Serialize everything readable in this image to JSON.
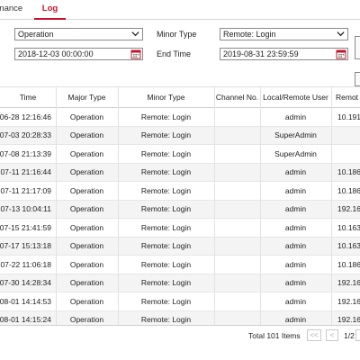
{
  "tabs": {
    "maintenance_partial": "enance",
    "log": "Log"
  },
  "filters": {
    "major_type": "Operation",
    "minor_type_label": "Minor Type",
    "minor_type": "Remote: Login",
    "start_time": "2018-12-03 00:00:00",
    "end_time_label": "End Time",
    "end_time": "2019-08-31 23:59:59"
  },
  "table": {
    "headers": [
      "Time",
      "Major Type",
      "Minor Type",
      "Channel No.",
      "Local/Remote User",
      "Remot"
    ],
    "rows": [
      [
        "06-28 12:16:46",
        "Operation",
        "Remote: Login",
        "",
        "admin",
        "10.191"
      ],
      [
        "07-03 20:28:33",
        "Operation",
        "Remote: Login",
        "",
        "SuperAdmin",
        ""
      ],
      [
        "07-08 21:13:39",
        "Operation",
        "Remote: Login",
        "",
        "SuperAdmin",
        ""
      ],
      [
        "07-11 21:16:44",
        "Operation",
        "Remote: Login",
        "",
        "admin",
        "10.186"
      ],
      [
        "07-11 21:17:09",
        "Operation",
        "Remote: Login",
        "",
        "admin",
        "10.186"
      ],
      [
        "07-13 10:04:11",
        "Operation",
        "Remote: Login",
        "",
        "admin",
        "192.16"
      ],
      [
        "07-15 21:41:59",
        "Operation",
        "Remote: Login",
        "",
        "admin",
        "10.163"
      ],
      [
        "07-17 15:13:18",
        "Operation",
        "Remote: Login",
        "",
        "admin",
        "10.163"
      ],
      [
        "07-22 11:06:18",
        "Operation",
        "Remote: Login",
        "",
        "admin",
        "10.186"
      ],
      [
        "07-30 14:28:34",
        "Operation",
        "Remote: Login",
        "",
        "admin",
        "192.16"
      ],
      [
        "08-01 14:14:53",
        "Operation",
        "Remote: Login",
        "",
        "admin",
        "192.16"
      ],
      [
        "08-01 14:15:24",
        "Operation",
        "Remote: Login",
        "",
        "admin",
        "192.16"
      ]
    ]
  },
  "pagination": {
    "total": "Total 101 Items",
    "first": "<<",
    "prev": "<",
    "page": "1/2"
  },
  "colors": {
    "accent": "#c8102e",
    "alt_row": "#f4f4f4",
    "border": "#8a8a8a"
  }
}
